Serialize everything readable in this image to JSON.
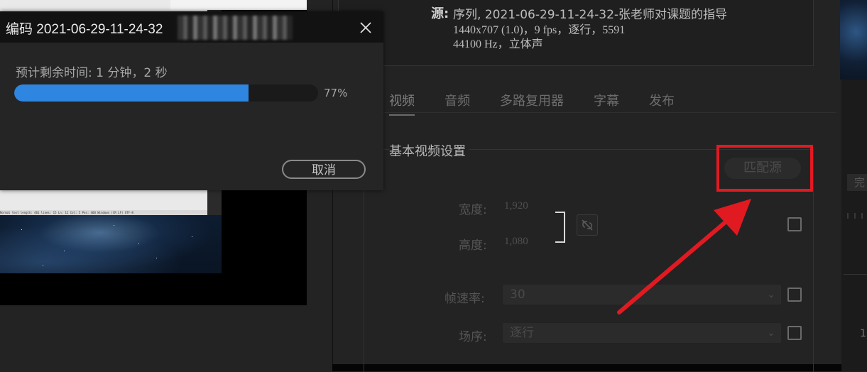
{
  "preview": {
    "status_bar_text": "Normal text length: 461   lines: 15           Ln: 12   Col: 5   Pos: 460                    Windows (CR LF)   UTF-8"
  },
  "encoding_dialog": {
    "title": "编码 2021-06-29-11-24-32",
    "remaining_label": "预计剩余时间: 1 分钟，2 秒",
    "progress": 0.77,
    "percent_text": "77%",
    "cancel_label": "取消",
    "colors": {
      "progress": "#2e86e0"
    }
  },
  "source_info": {
    "label": "源:",
    "line1": "序列, 2021-06-29-11-24-32-张老师对课题的指导",
    "line2": "1440x707 (1.0)，9 fps，逐行，5591",
    "line3": "44100 Hz，立体声"
  },
  "tabs": [
    {
      "label": "视频",
      "active": true
    },
    {
      "label": "音频",
      "active": false
    },
    {
      "label": "多路复用器",
      "active": false
    },
    {
      "label": "字幕",
      "active": false
    },
    {
      "label": "发布",
      "active": false
    }
  ],
  "video_settings": {
    "section_title": "基本视频设置",
    "match_source_label": "匹配源",
    "width_label": "宽度:",
    "width_value": "1,920",
    "height_label": "高度:",
    "height_value": "1,080",
    "frame_rate_label": "帧速率:",
    "frame_rate_value": "30",
    "field_order_label": "场序:",
    "field_order_value": "逐行",
    "highlight_color": "#e11a22"
  },
  "edge_panel": {
    "button_partial": "完",
    "value_partial": "1"
  }
}
